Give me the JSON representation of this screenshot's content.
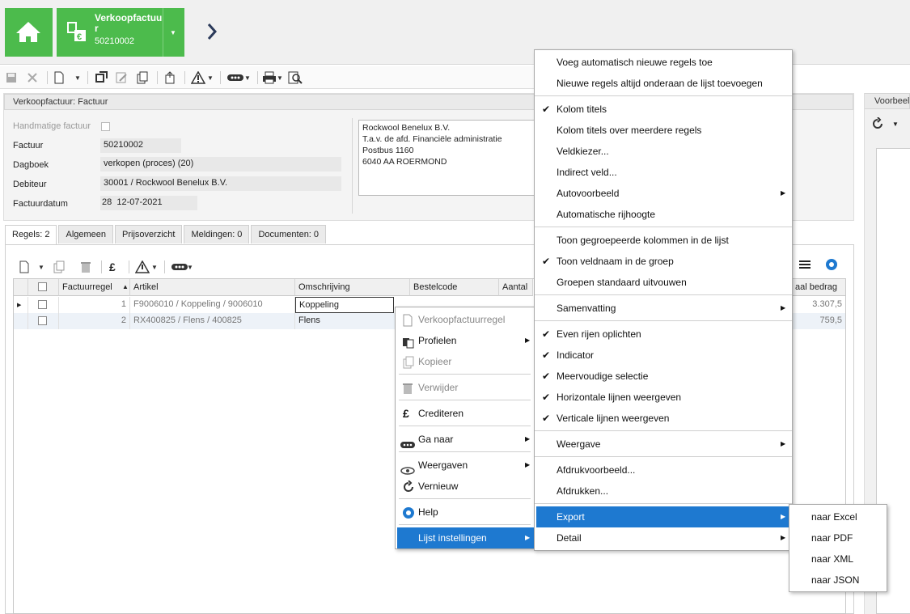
{
  "header": {
    "doc_title": "Verkoopfactuu r",
    "doc_number": "50210002"
  },
  "panel": {
    "title": "Verkoopfactuur: Factuur",
    "manual_label": "Handmatige factuur",
    "fields": [
      {
        "label": "Factuur",
        "value": "50210002"
      },
      {
        "label": "Dagboek",
        "value": "verkopen (proces) (20)"
      },
      {
        "label": "Debiteur",
        "value": "30001 / Rockwool Benelux B.V."
      },
      {
        "label": "Factuurdatum",
        "value_a": "28",
        "value_b": "12-07-2021"
      }
    ],
    "address": [
      "Rockwool Benelux B.V.",
      "T.a.v. de afd. Financiële administratie",
      "Postbus 1160",
      "6040 AA ROERMOND"
    ]
  },
  "right_panel": {
    "title": "Voorbeel"
  },
  "tabs": [
    "Regels: 2",
    "Algemeen",
    "Prijsoverzicht",
    "Meldingen: 0",
    "Documenten: 0"
  ],
  "grid": {
    "columns": [
      "Factuurregel",
      "Artikel",
      "Omschrijving",
      "Bestelcode",
      "Aantal",
      "aal bedrag"
    ],
    "rows": [
      {
        "regel": "1",
        "artikel": "F9006010 / Koppeling / 9006010",
        "omschrijving": "Koppeling",
        "bedrag": "3.307,5"
      },
      {
        "regel": "2",
        "artikel": "RX400825 / Flens / 400825",
        "omschrijving": "Flens",
        "bedrag": "759,5"
      }
    ]
  },
  "context_menu": {
    "items": [
      "Verkoopfactuurregel",
      "Profielen",
      "Kopieer",
      "Verwijder",
      "Crediteren",
      "Ga naar",
      "Weergaven",
      "Vernieuw",
      "Help",
      "Lijst instellingen"
    ]
  },
  "settings_menu": {
    "items": [
      "Voeg automatisch nieuwe regels toe",
      "Nieuwe regels altijd onderaan de lijst toevoegen",
      "Kolom titels",
      "Kolom titels over meerdere regels",
      "Veldkiezer...",
      "Indirect veld...",
      "Autovoorbeeld",
      "Automatische rijhoogte",
      "Toon gegroepeerde kolommen in de lijst",
      "Toon veldnaam in de groep",
      "Groepen standaard uitvouwen",
      "Samenvatting",
      "Even rijen oplichten",
      "Indicator",
      "Meervoudige selectie",
      "Horizontale lijnen weergeven",
      "Verticale lijnen weergeven",
      "Weergave",
      "Afdrukvoorbeeld...",
      "Afdrukken...",
      "Export",
      "Detail"
    ]
  },
  "export_menu": {
    "items": [
      "naar Excel",
      "naar PDF",
      "naar XML",
      "naar JSON"
    ]
  },
  "colors": {
    "accent_green": "#4cbb4c",
    "highlight_blue": "#1e79d0"
  }
}
